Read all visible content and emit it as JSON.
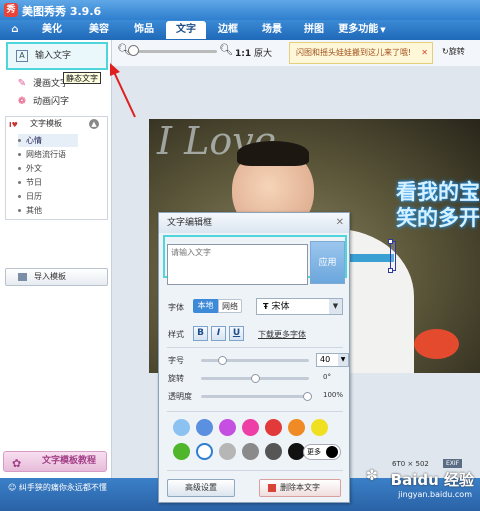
{
  "window": {
    "title": "美图秀秀 3.9.6",
    "icon_text": "秀"
  },
  "menu": {
    "tabs": [
      {
        "label": "美化"
      },
      {
        "label": "美容"
      },
      {
        "label": "饰品"
      },
      {
        "label": "文字"
      },
      {
        "label": "边框"
      },
      {
        "label": "场景"
      },
      {
        "label": "拼图"
      },
      {
        "label": "更多功能"
      }
    ],
    "active": "文字"
  },
  "toolbar": {
    "zoom_ratio": "1:1",
    "zoom_ratio_label": "原大",
    "notice": "闪图和摇头娃娃搬到这儿来了哦!",
    "rotate_label": "旋转"
  },
  "sidebar": {
    "items": [
      {
        "label": "输入文字"
      },
      {
        "label": "漫画文字"
      },
      {
        "label": "动画闪字"
      }
    ],
    "tooltip": "静态文字",
    "template_header": "文字模板",
    "template_items": [
      {
        "label": "心情"
      },
      {
        "label": "网络流行语"
      },
      {
        "label": "外文"
      },
      {
        "label": "节日"
      },
      {
        "label": "日历"
      },
      {
        "label": "其他"
      }
    ],
    "import_label": "导入模板",
    "tutorial_label": "文字模板教程"
  },
  "status": {
    "text": "纠手狭的痛你永远都不懂"
  },
  "canvas": {
    "overlay_text_1": "看我的宝",
    "overlay_text_2": "笑的多开",
    "deco_text": "I Love",
    "dims_left": "6T0",
    "dims_right": "502",
    "exif": "EXIF"
  },
  "dialog": {
    "title": "文字编辑框",
    "input_placeholder": "请输入文字",
    "apply_label": "应用",
    "font_label": "字体",
    "local_tab": "本地",
    "web_tab": "网络",
    "font_value": "宋体",
    "style_label": "样式",
    "bold": "B",
    "italic": "I",
    "underline": "U",
    "more_fonts": "下载更多字体",
    "size_label": "字号",
    "size_value": "40",
    "rotate_label": "旋转",
    "rotate_value": "0°",
    "opacity_label": "透明度",
    "opacity_value": "100%",
    "more_colors": "更多",
    "advanced": "高级设置",
    "delete": "删除本文字"
  },
  "colors": {
    "swatches": [
      "#8cc2f2",
      "#5b8fe0",
      "#c54fe0",
      "#ee3fa6",
      "#e23a3a",
      "#f08a24",
      "#f0e022",
      "#4fb52a",
      "#ffffff",
      "#b6b6b6",
      "#8a8a8a",
      "#565656",
      "#111111"
    ]
  },
  "watermark": {
    "brand": "Baidu 经验",
    "url": "jingyan.baidu.com"
  }
}
